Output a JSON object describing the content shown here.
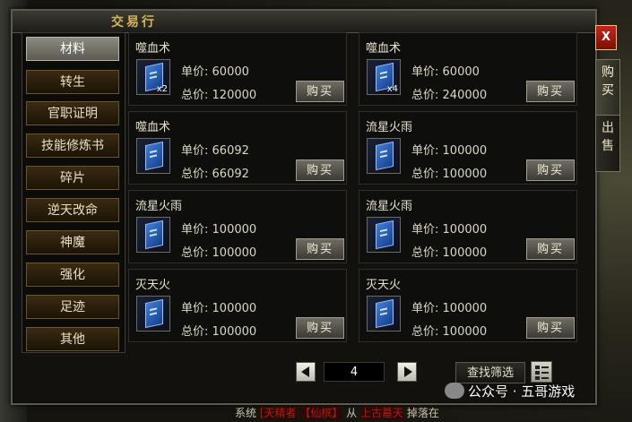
{
  "window": {
    "title": "交易行"
  },
  "close_label": "X",
  "side_tabs": [
    {
      "label": "购\n买",
      "active": true
    },
    {
      "label": "出\n售",
      "active": false
    }
  ],
  "categories": [
    {
      "label": "材料",
      "active": true
    },
    {
      "label": "转生"
    },
    {
      "label": "官职证明"
    },
    {
      "label": "技能修炼书"
    },
    {
      "label": "碎片"
    },
    {
      "label": "逆天改命"
    },
    {
      "label": "神魔"
    },
    {
      "label": "强化"
    },
    {
      "label": "足迹"
    },
    {
      "label": "其他"
    }
  ],
  "price_labels": {
    "unit": "单价:",
    "total": "总价:"
  },
  "buy_label": "购买",
  "items": [
    {
      "name": "噬血术",
      "unit_price": "60000",
      "total_price": "120000",
      "qty": "x2",
      "icon": "blue-skill-book-icon"
    },
    {
      "name": "噬血术",
      "unit_price": "60000",
      "total_price": "240000",
      "qty": "x4",
      "icon": "blue-skill-book-icon"
    },
    {
      "name": "噬血术",
      "unit_price": "66092",
      "total_price": "66092",
      "qty": "",
      "icon": "blue-skill-book-icon"
    },
    {
      "name": "流星火雨",
      "unit_price": "100000",
      "total_price": "100000",
      "qty": "",
      "icon": "blue-skill-book-icon"
    },
    {
      "name": "流星火雨",
      "unit_price": "100000",
      "total_price": "100000",
      "qty": "",
      "icon": "blue-skill-book-icon"
    },
    {
      "name": "流星火雨",
      "unit_price": "100000",
      "total_price": "100000",
      "qty": "",
      "icon": "blue-skill-book-icon"
    },
    {
      "name": "灭天火",
      "unit_price": "100000",
      "total_price": "100000",
      "qty": "",
      "icon": "blue-skill-book-icon"
    },
    {
      "name": "灭天火",
      "unit_price": "100000",
      "total_price": "100000",
      "qty": "",
      "icon": "blue-skill-book-icon"
    }
  ],
  "pagination": {
    "page": "4"
  },
  "filter_label": "查找筛选",
  "chat": {
    "channel": "系统",
    "name1": "[天精者",
    "name2": "【仙槟】",
    "text1": "从",
    "place": "上古墓天",
    "text2": "掉落在"
  },
  "watermark": "公众号 · 五哥游戏",
  "colors": {
    "accent_gold": "#d8b45a",
    "close_red": "#c9241a",
    "book_blue": "#3f7dd6"
  }
}
